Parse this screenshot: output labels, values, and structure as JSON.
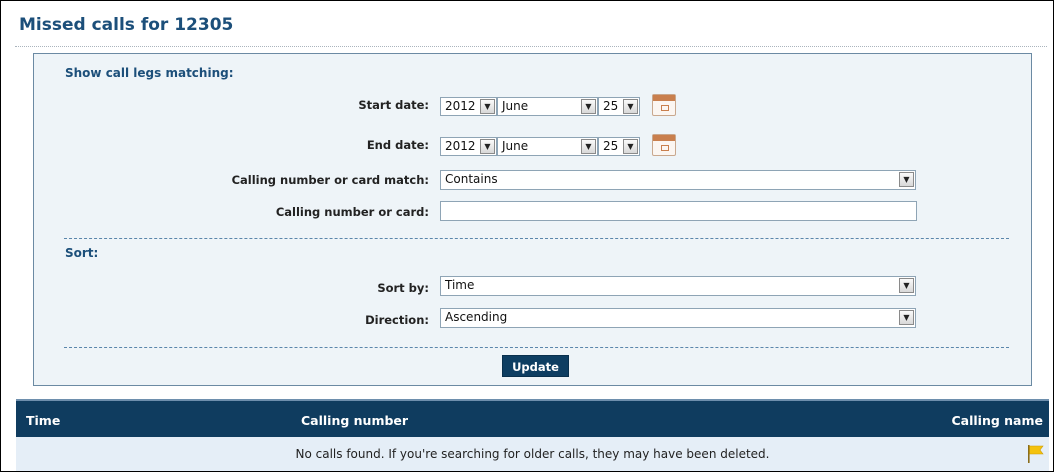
{
  "page": {
    "title": "Missed calls for 12305"
  },
  "filter": {
    "heading": "Show call legs matching:",
    "start_date": {
      "label": "Start date:",
      "year": "2012",
      "month": "June",
      "day": "25"
    },
    "end_date": {
      "label": "End date:",
      "year": "2012",
      "month": "June",
      "day": "25"
    },
    "match_type": {
      "label": "Calling number or card match:",
      "value": "Contains"
    },
    "number_or_card": {
      "label": "Calling number or card:",
      "value": ""
    }
  },
  "sort": {
    "heading": "Sort:",
    "sort_by": {
      "label": "Sort by:",
      "value": "Time"
    },
    "direction": {
      "label": "Direction:",
      "value": "Ascending"
    }
  },
  "update_label": "Update",
  "table": {
    "columns": [
      "Time",
      "Calling number",
      "Calling name"
    ],
    "empty_message": "No calls found. If you're searching for older calls, they may have been deleted."
  },
  "icons": {
    "calendar": "calendar-icon",
    "dropdown": "chevron-down-icon",
    "flag": "flag-icon"
  },
  "colors": {
    "title": "#1c4f7a",
    "table_header": "#0f3c5f",
    "update_button": "#0e3e62",
    "panel_background": "#eef4f8",
    "row_background": "#e5eef7",
    "flag": "#f4c20d"
  }
}
